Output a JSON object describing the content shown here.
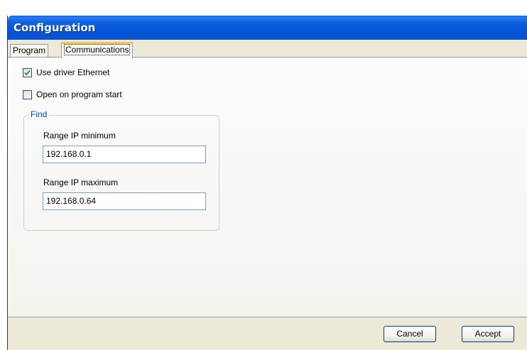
{
  "window": {
    "title": "Configuration"
  },
  "tabs": [
    {
      "label": "Program",
      "active": false
    },
    {
      "label": "Communications",
      "active": true
    }
  ],
  "options": {
    "use_driver": {
      "label": "Use driver Ethernet",
      "checked": true
    },
    "open_on_start": {
      "label": "Open on program start",
      "checked": false
    }
  },
  "find_group": {
    "legend": "Find",
    "range_min": {
      "label": "Range IP minimum",
      "value": "192.168.0.1"
    },
    "range_max": {
      "label": "Range IP maximum",
      "value": "192.168.0.64"
    }
  },
  "buttons": {
    "cancel": "Cancel",
    "accept": "Accept"
  },
  "colors": {
    "titlebar": "#0a5de5",
    "legend": "#0046d5",
    "check": "#21a121",
    "active_tab_accent": "#ffc83c"
  }
}
